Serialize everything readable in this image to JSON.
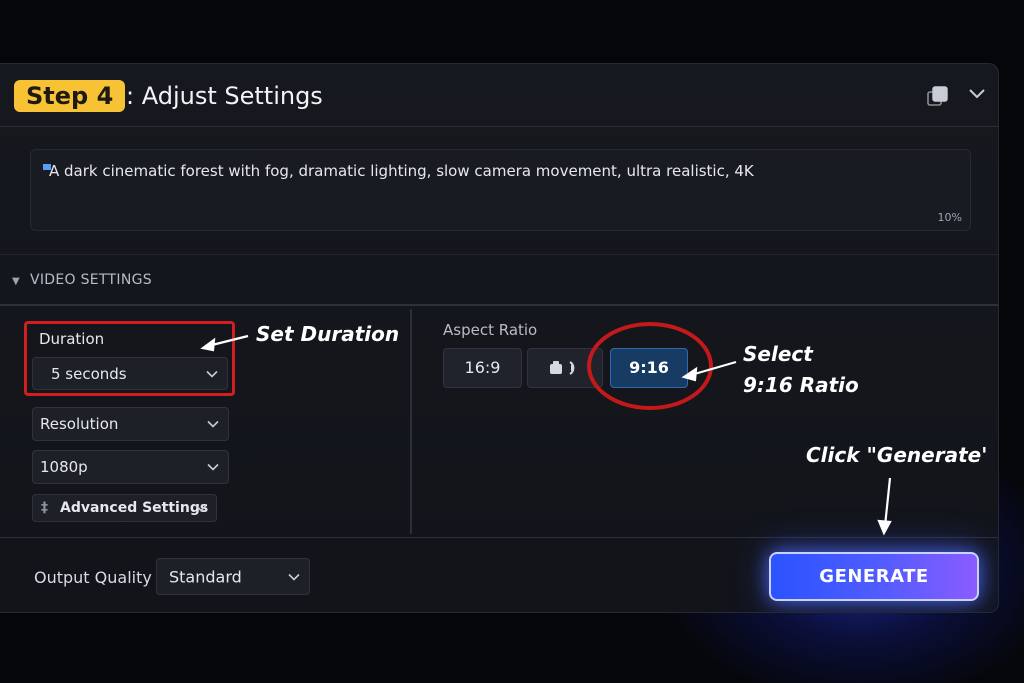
{
  "header": {
    "step_badge": "Step 4",
    "title": ": Adjust Settings"
  },
  "prompt": {
    "text": "A dark cinematic forest with fog, dramatic lighting, slow camera movement, ultra realistic, 4K",
    "counter": "10%"
  },
  "video_settings": {
    "section_title": "VIDEO SETTINGS",
    "duration": {
      "label": "Duration",
      "value": "5 seconds"
    },
    "resolution": {
      "label": "Resolution",
      "value": "1080p"
    },
    "advanced_label": "Advanced Settings",
    "aspect_ratio": {
      "label": "Aspect Ratio",
      "options": [
        "16:9",
        "9:16"
      ],
      "selected": "9:16"
    }
  },
  "footer": {
    "output_quality_label": "Output Quality",
    "output_quality_value": "Standard",
    "generate_label": "GENERATE"
  },
  "annotations": {
    "set_duration": "Set Duration",
    "select_ratio_line1": "Select",
    "select_ratio_line2": "9:16 Ratio",
    "click_generate": "Click \"Generate'"
  },
  "colors": {
    "badge": "#f7c233",
    "highlight_red": "#d11f1f",
    "selected_ratio": "#173b63",
    "generate_start": "#2b53ff",
    "generate_end": "#8a5cff"
  }
}
